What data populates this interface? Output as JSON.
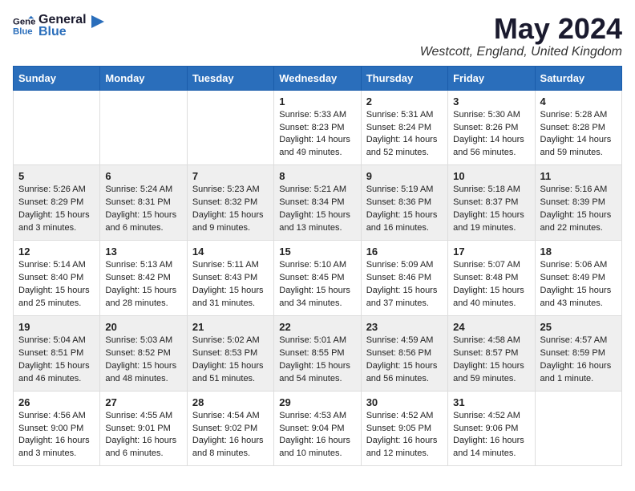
{
  "header": {
    "logo_general": "General",
    "logo_blue": "Blue",
    "main_title": "May 2024",
    "subtitle": "Westcott, England, United Kingdom"
  },
  "calendar": {
    "days_of_week": [
      "Sunday",
      "Monday",
      "Tuesday",
      "Wednesday",
      "Thursday",
      "Friday",
      "Saturday"
    ],
    "weeks": [
      [
        {
          "day": "",
          "info": ""
        },
        {
          "day": "",
          "info": ""
        },
        {
          "day": "",
          "info": ""
        },
        {
          "day": "1",
          "info": "Sunrise: 5:33 AM\nSunset: 8:23 PM\nDaylight: 14 hours\nand 49 minutes."
        },
        {
          "day": "2",
          "info": "Sunrise: 5:31 AM\nSunset: 8:24 PM\nDaylight: 14 hours\nand 52 minutes."
        },
        {
          "day": "3",
          "info": "Sunrise: 5:30 AM\nSunset: 8:26 PM\nDaylight: 14 hours\nand 56 minutes."
        },
        {
          "day": "4",
          "info": "Sunrise: 5:28 AM\nSunset: 8:28 PM\nDaylight: 14 hours\nand 59 minutes."
        }
      ],
      [
        {
          "day": "5",
          "info": "Sunrise: 5:26 AM\nSunset: 8:29 PM\nDaylight: 15 hours\nand 3 minutes."
        },
        {
          "day": "6",
          "info": "Sunrise: 5:24 AM\nSunset: 8:31 PM\nDaylight: 15 hours\nand 6 minutes."
        },
        {
          "day": "7",
          "info": "Sunrise: 5:23 AM\nSunset: 8:32 PM\nDaylight: 15 hours\nand 9 minutes."
        },
        {
          "day": "8",
          "info": "Sunrise: 5:21 AM\nSunset: 8:34 PM\nDaylight: 15 hours\nand 13 minutes."
        },
        {
          "day": "9",
          "info": "Sunrise: 5:19 AM\nSunset: 8:36 PM\nDaylight: 15 hours\nand 16 minutes."
        },
        {
          "day": "10",
          "info": "Sunrise: 5:18 AM\nSunset: 8:37 PM\nDaylight: 15 hours\nand 19 minutes."
        },
        {
          "day": "11",
          "info": "Sunrise: 5:16 AM\nSunset: 8:39 PM\nDaylight: 15 hours\nand 22 minutes."
        }
      ],
      [
        {
          "day": "12",
          "info": "Sunrise: 5:14 AM\nSunset: 8:40 PM\nDaylight: 15 hours\nand 25 minutes."
        },
        {
          "day": "13",
          "info": "Sunrise: 5:13 AM\nSunset: 8:42 PM\nDaylight: 15 hours\nand 28 minutes."
        },
        {
          "day": "14",
          "info": "Sunrise: 5:11 AM\nSunset: 8:43 PM\nDaylight: 15 hours\nand 31 minutes."
        },
        {
          "day": "15",
          "info": "Sunrise: 5:10 AM\nSunset: 8:45 PM\nDaylight: 15 hours\nand 34 minutes."
        },
        {
          "day": "16",
          "info": "Sunrise: 5:09 AM\nSunset: 8:46 PM\nDaylight: 15 hours\nand 37 minutes."
        },
        {
          "day": "17",
          "info": "Sunrise: 5:07 AM\nSunset: 8:48 PM\nDaylight: 15 hours\nand 40 minutes."
        },
        {
          "day": "18",
          "info": "Sunrise: 5:06 AM\nSunset: 8:49 PM\nDaylight: 15 hours\nand 43 minutes."
        }
      ],
      [
        {
          "day": "19",
          "info": "Sunrise: 5:04 AM\nSunset: 8:51 PM\nDaylight: 15 hours\nand 46 minutes."
        },
        {
          "day": "20",
          "info": "Sunrise: 5:03 AM\nSunset: 8:52 PM\nDaylight: 15 hours\nand 48 minutes."
        },
        {
          "day": "21",
          "info": "Sunrise: 5:02 AM\nSunset: 8:53 PM\nDaylight: 15 hours\nand 51 minutes."
        },
        {
          "day": "22",
          "info": "Sunrise: 5:01 AM\nSunset: 8:55 PM\nDaylight: 15 hours\nand 54 minutes."
        },
        {
          "day": "23",
          "info": "Sunrise: 4:59 AM\nSunset: 8:56 PM\nDaylight: 15 hours\nand 56 minutes."
        },
        {
          "day": "24",
          "info": "Sunrise: 4:58 AM\nSunset: 8:57 PM\nDaylight: 15 hours\nand 59 minutes."
        },
        {
          "day": "25",
          "info": "Sunrise: 4:57 AM\nSunset: 8:59 PM\nDaylight: 16 hours\nand 1 minute."
        }
      ],
      [
        {
          "day": "26",
          "info": "Sunrise: 4:56 AM\nSunset: 9:00 PM\nDaylight: 16 hours\nand 3 minutes."
        },
        {
          "day": "27",
          "info": "Sunrise: 4:55 AM\nSunset: 9:01 PM\nDaylight: 16 hours\nand 6 minutes."
        },
        {
          "day": "28",
          "info": "Sunrise: 4:54 AM\nSunset: 9:02 PM\nDaylight: 16 hours\nand 8 minutes."
        },
        {
          "day": "29",
          "info": "Sunrise: 4:53 AM\nSunset: 9:04 PM\nDaylight: 16 hours\nand 10 minutes."
        },
        {
          "day": "30",
          "info": "Sunrise: 4:52 AM\nSunset: 9:05 PM\nDaylight: 16 hours\nand 12 minutes."
        },
        {
          "day": "31",
          "info": "Sunrise: 4:52 AM\nSunset: 9:06 PM\nDaylight: 16 hours\nand 14 minutes."
        },
        {
          "day": "",
          "info": ""
        }
      ]
    ]
  }
}
